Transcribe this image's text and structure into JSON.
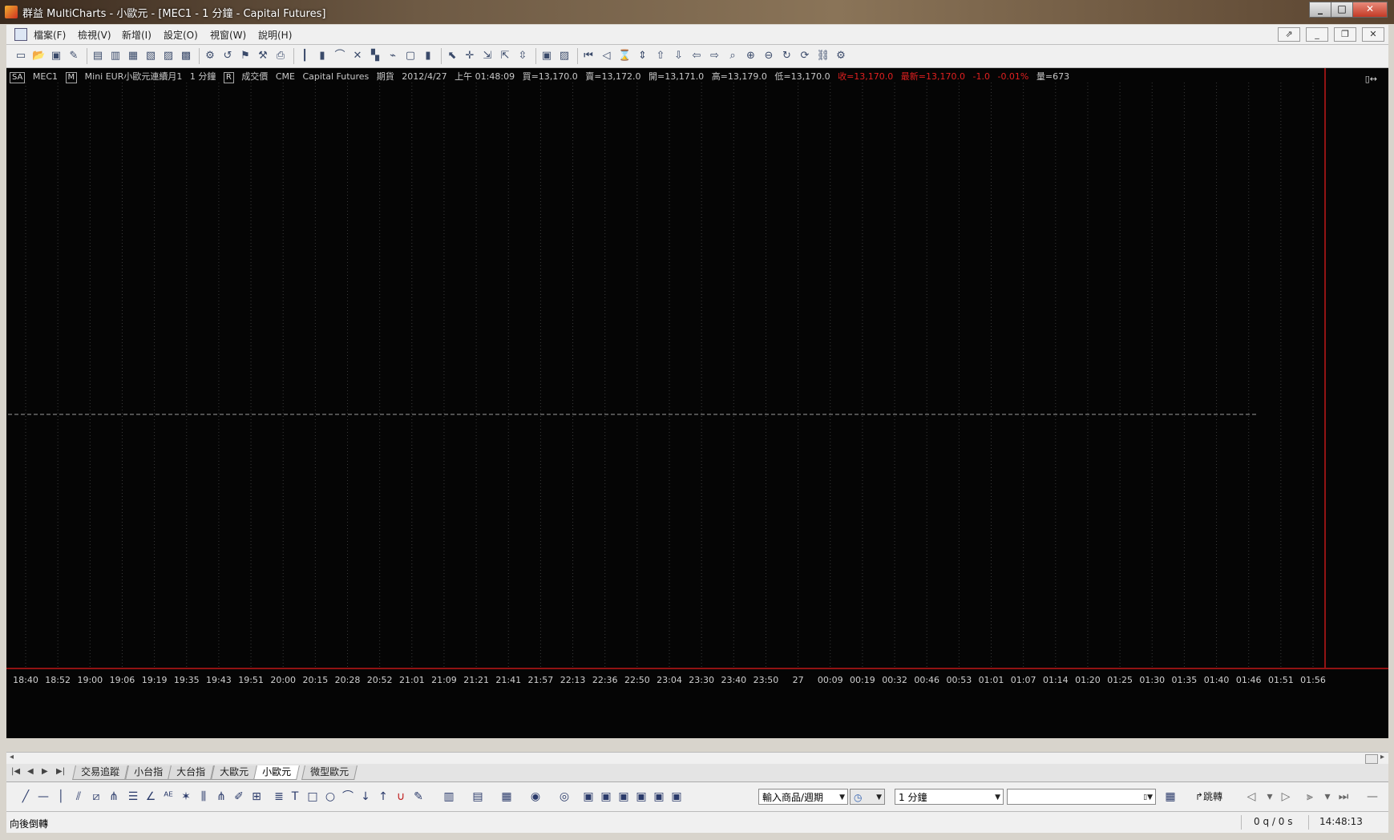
{
  "window": {
    "title": "群益 MultiCharts - 小歐元 - [MEC1 - 1 分鐘 - Capital Futures]",
    "min": "_",
    "max": "□",
    "close": "✕"
  },
  "menu": {
    "items": [
      "檔案(F)",
      "檢視(V)",
      "新增(I)",
      "設定(O)",
      "視窗(W)",
      "說明(H)"
    ],
    "mdi_buttons": [
      "⇗",
      "_",
      "❐",
      "✕"
    ]
  },
  "toolbar": {
    "icons": [
      "new-chart-icon",
      "open-icon",
      "save-icon",
      "edit-icon",
      "window1-icon",
      "window2-icon",
      "window3-icon",
      "window4-icon",
      "window5-icon",
      "window6-icon",
      "format-symbol-icon",
      "link-icon",
      "indicator-icon",
      "strategy-icon",
      "print-icon",
      "bar-icon",
      "candle-icon",
      "line-icon",
      "point-figure-icon",
      "renko-icon",
      "kagi-icon",
      "box-icon",
      "volume-icon",
      "pointer-icon",
      "crosshair-icon",
      "drag-zoom-icon",
      "drag-pan-icon",
      "drag-scroll-icon",
      "snapshot-icon",
      "image-icon",
      "first-bar-icon",
      "prev-bar-icon",
      "scale-icon",
      "expand-icon",
      "up-icon",
      "down-icon",
      "left-icon",
      "right-icon",
      "zoom-icon",
      "zoom-in-icon",
      "zoom-out-icon",
      "refresh-icon",
      "sync-icon",
      "link2-icon",
      "settings-icon"
    ]
  },
  "chart": {
    "mode_box": "SA",
    "symbol": "MEC1",
    "m_box": "M",
    "description": "Mini EUR小歐元連續月1",
    "interval": "1 分鐘",
    "r_box": "R",
    "field": "成交價",
    "exchange": "CME",
    "broker": "Capital Futures",
    "category": "期貨",
    "date": "2012/4/27",
    "time": "上午 01:48:09",
    "bid": "買=13,170.0",
    "ask": "賣=13,172.0",
    "open": "開=13,171.0",
    "high": "高=13,179.0",
    "low": "低=13,170.0",
    "close": "收=13,170.0",
    "last": "最新=13,170.0",
    "change": "-1.0",
    "change_pct": "-0.01%",
    "volume": "量=673",
    "xaxis_labels": [
      "18:40",
      "18:52",
      "19:00",
      "19:06",
      "19:19",
      "19:35",
      "19:43",
      "19:51",
      "20:00",
      "20:15",
      "20:28",
      "20:52",
      "21:01",
      "21:09",
      "21:21",
      "21:41",
      "21:57",
      "22:13",
      "22:36",
      "22:50",
      "23:04",
      "23:30",
      "23:40",
      "23:50",
      "27",
      "00:09",
      "00:19",
      "00:32",
      "00:46",
      "00:53",
      "01:01",
      "01:07",
      "01:14",
      "01:20",
      "01:25",
      "01:30",
      "01:35",
      "01:40",
      "01:46",
      "01:51",
      "01:56"
    ],
    "colors": {
      "background": "#050505",
      "grid": "#3a3a3a",
      "red_line": "#c01818",
      "dashed": "#9a9a9a",
      "red_text": "#e02020"
    }
  },
  "tabs": {
    "items": [
      "交易追蹤",
      "小台指",
      "大台指",
      "大歐元",
      "小歐元",
      "微型歐元"
    ],
    "active_index": 4,
    "nav": [
      "|◀",
      "◀",
      "▶",
      "▶|"
    ]
  },
  "drawbar": {
    "symbol_combo": "輸入商品/週期",
    "interval_combo": "1 分鐘",
    "search_value": "",
    "jump_label": "跳轉"
  },
  "status": {
    "left_text": "向後倒轉",
    "queue": "0 q / 0 s",
    "clock": "14:48:13"
  }
}
